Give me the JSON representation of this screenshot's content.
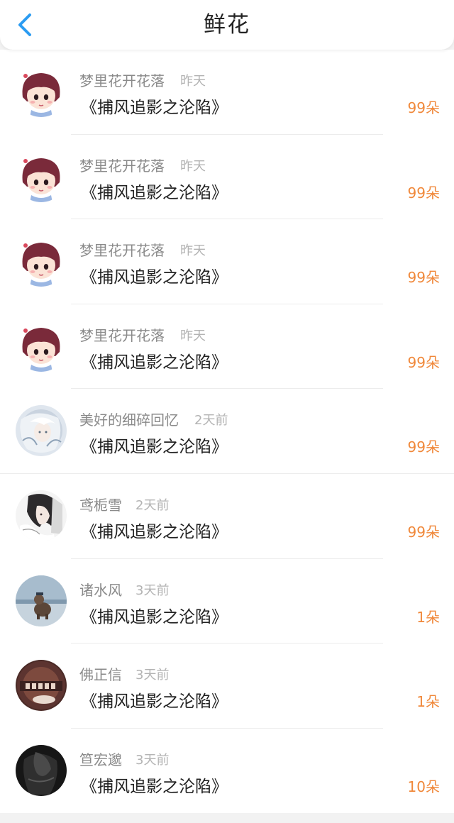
{
  "header": {
    "title": "鲜花",
    "back_icon": "chevron-left-icon",
    "accent_color": "#2b9cf2"
  },
  "list": {
    "items": [
      {
        "name": "梦里花开花落",
        "time": "昨天",
        "work": "《捕风追影之沦陷》",
        "count": "99朵",
        "avatar": "cartoon-girl"
      },
      {
        "name": "梦里花开花落",
        "time": "昨天",
        "work": "《捕风追影之沦陷》",
        "count": "99朵",
        "avatar": "cartoon-girl"
      },
      {
        "name": "梦里花开花落",
        "time": "昨天",
        "work": "《捕风追影之沦陷》",
        "count": "99朵",
        "avatar": "cartoon-girl"
      },
      {
        "name": "梦里花开花落",
        "time": "昨天",
        "work": "《捕风追影之沦陷》",
        "count": "99朵",
        "avatar": "cartoon-girl"
      },
      {
        "name": "美好的细碎回忆",
        "time": "2天前",
        "work": "《捕风追影之沦陷》",
        "count": "99朵",
        "avatar": "white-hair-anime"
      },
      {
        "name": "鸢栀雪",
        "time": "2天前",
        "work": "《捕风追影之沦陷》",
        "count": "99朵",
        "avatar": "sketch-portrait"
      },
      {
        "name": "诸水风",
        "time": "3天前",
        "work": "《捕风追影之沦陷》",
        "count": "1朵",
        "avatar": "lake-dog"
      },
      {
        "name": "佛正信",
        "time": "3天前",
        "work": "《捕风追影之沦陷》",
        "count": "1朵",
        "avatar": "brown-badge"
      },
      {
        "name": "笪宏邈",
        "time": "3天前",
        "work": "《捕风追影之沦陷》",
        "count": "10朵",
        "avatar": "dark-figure"
      }
    ],
    "count_color": "#f0883a"
  }
}
